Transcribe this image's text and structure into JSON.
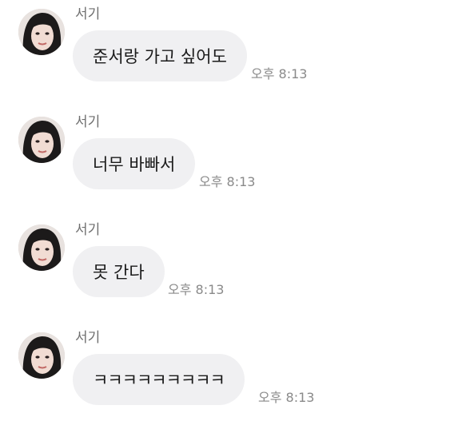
{
  "messages": [
    {
      "sender": "서기",
      "text": "준서랑 가고 싶어도",
      "time": "오후 8:13"
    },
    {
      "sender": "서기",
      "text": "너무 바빠서",
      "time": "오후 8:13"
    },
    {
      "sender": "서기",
      "text": "못 간다",
      "time": "오후 8:13"
    },
    {
      "sender": "서기",
      "text": "ㅋㅋㅋㅋㅋㅋㅋㅋㅋ",
      "time": "오후 8:13"
    }
  ],
  "colors": {
    "bubble": "#f0f0f2",
    "sender_text": "#6e6e6e",
    "time_text": "#8a8a8a"
  },
  "icons": {
    "avatar": "profile-photo"
  }
}
